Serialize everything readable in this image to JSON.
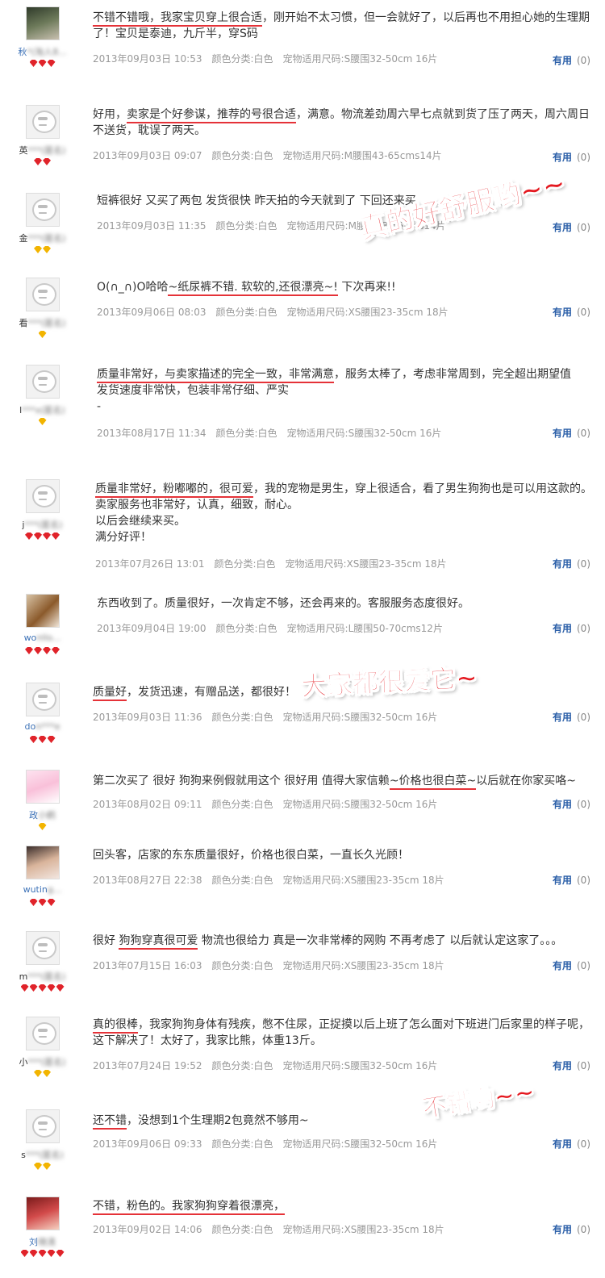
{
  "useful_label": "有用",
  "reviews": [
    {
      "user": "秋",
      "user_masked": "*(淘人8...",
      "content_html": "<span class='u'>不错不错哦，我家宝贝穿上很合适</span>，刚开始不太习惯，但一会就好了，以后再也不用担心她的生理期了！宝贝是泰迪，九斤半，穿S码",
      "date": "2013年09月03日 10:53",
      "color": "颜色分类:白色",
      "size": "宠物适用尺码:S腰围32-50cm 16片",
      "useful_count": "(0)"
    },
    {
      "user": "英",
      "user_masked": "***(匿名)",
      "content_html": "好用，<span class='u'>卖家是个好参谋，推荐的号很合适</span>，满意。物流差劲周六早七点就到货了压了两天，周六周日不送货，耽误了两天。",
      "date": "2013年09月03日 09:07",
      "color": "颜色分类:白色",
      "size": "宠物适用尺码:M腰围43-65cms14片",
      "useful_count": "(0)"
    },
    {
      "user": "金",
      "user_masked": "***(匿名)",
      "content_html": "短裤很好 又买了两包 发货很快 昨天拍的今天就到了 下回还来买",
      "date": "2013年09月03日 11:35",
      "color": "颜色分类:白色",
      "size": "宠物适用尺码:M腰围43-65cms14片",
      "useful_count": "(0)"
    },
    {
      "user": "看",
      "user_masked": "***(匿名)",
      "content_html": "O(∩_∩)O哈哈<span class='u'>~纸尿裤不错. 软软的,还很漂亮~!</span> 下次再来!!",
      "date": "2013年09月06日 08:03",
      "color": "颜色分类:白色",
      "size": "宠物适用尺码:XS腰围23-35cm 18片",
      "useful_count": "(0)"
    },
    {
      "user": "l",
      "user_masked": "***x(匿名)",
      "content_html": "<span class='u'>质量非常好，与卖家描述的完全一致，非常满意</span>，服务太棒了，考虑非常周到，完全超出期望值<br>发货速度非常快，包装非常仔细、严实<br>-",
      "date": "2013年08月17日 11:34",
      "color": "颜色分类:白色",
      "size": "宠物适用尺码:S腰围32-50cm 16片",
      "useful_count": "(0)"
    },
    {
      "user": "j",
      "user_masked": "***(匿名)",
      "content_html": "<span class='u'>质量非常好，粉嘟嘟的，很可爱</span>，我的宠物是男生，穿上很适合，看了男生狗狗也是可以用这款的。<br>卖家服务也非常好，认真，细致，耐心。<br>以后会继续来买。<br>满分好评！",
      "date": "2013年07月26日 13:01",
      "color": "颜色分类:白色",
      "size": "宠物适用尺码:XS腰围23-35cm 18片",
      "useful_count": "(0)"
    },
    {
      "user": "wo",
      "user_masked": "nllo...",
      "content_html": "东西收到了。质量很好，一次肯定不够，还会再来的。客服服务态度很好。",
      "date": "2013年09月04日 19:00",
      "color": "颜色分类:白色",
      "size": "宠物适用尺码:L腰围50-70cms12片",
      "useful_count": "(0)"
    },
    {
      "user": "do",
      "user_masked": "n***e",
      "content_html": "<span class='u'>质量好</span>，发货迅速，有赠品送，都很好！",
      "date": "2013年09月03日 11:36",
      "color": "颜色分类:白色",
      "size": "宠物适用尺码:S腰围32-50cm 16片",
      "useful_count": "(0)"
    },
    {
      "user": "政",
      "user_masked": "小鹤",
      "content_html": "第二次买了 很好 狗狗来例假就用这个 很好用 值得大家信赖<span class='u'>~价格也很白菜~</span>以后就在你家买咯~",
      "date": "2013年08月02日 09:11",
      "color": "颜色分类:白色",
      "size": "宠物适用尺码:S腰围32-50cm 16片",
      "useful_count": "(0)"
    },
    {
      "user": "wutin",
      "user_masked": "g...",
      "content_html": "回头客，店家的东东质量很好，价格也很白菜，一直长久光顾！",
      "date": "2013年08月27日 22:38",
      "color": "颜色分类:白色",
      "size": "宠物适用尺码:XS腰围23-35cm 18片",
      "useful_count": "(0)"
    },
    {
      "user": "m",
      "user_masked": "***(匿名)",
      "content_html": "很好 <span class='u'>狗狗穿真很可爱</span> 物流也很给力 真是一次非常棒的网购 不再考虑了 以后就认定这家了。。。",
      "date": "2013年07月15日 16:03",
      "color": "颜色分类:白色",
      "size": "宠物适用尺码:XS腰围23-35cm 18片",
      "useful_count": "(0)"
    },
    {
      "user": "小",
      "user_masked": "***(匿名)",
      "content_html": "<span class='u'>真的很棒</span>，我家狗狗身体有残疾，憋不住尿，正捉摸以后上班了怎么面对下班进门后家里的样子呢，这下解决了！太好了，我家比熊，体重13斤。",
      "date": "2013年07月24日 19:52",
      "color": "颜色分类:白色",
      "size": "宠物适用尺码:S腰围32-50cm 16片",
      "useful_count": "(0)"
    },
    {
      "user": "s",
      "user_masked": "***(匿名)",
      "content_html": "<span class='u'>还不错</span>，没想到1个生理期2包竟然不够用~",
      "date": "2013年09月06日 09:33",
      "color": "颜色分类:白色",
      "size": "宠物适用尺码:S腰围32-50cm 16片",
      "useful_count": "(0)"
    },
    {
      "user": "刘",
      "user_masked": "晓清",
      "content_html": "<span class='u'>不错，粉色的。我家狗狗穿着很漂亮，</span>",
      "date": "2013年09月02日 14:06",
      "color": "颜色分类:白色",
      "size": "宠物适用尺码:XS腰围23-35cm 18片",
      "useful_count": "(0)"
    }
  ],
  "overlays": {
    "stamp1": "真的好舒服哟~~",
    "stamp2": "大家都很爱它~",
    "stamp3": "不错哟~~"
  },
  "colors": {
    "underline": "#e53238",
    "stamp": "#e4181f",
    "useful_link": "#2b5fa8",
    "badge_red": "#e0232a",
    "badge_yellow": "#f2b400"
  }
}
